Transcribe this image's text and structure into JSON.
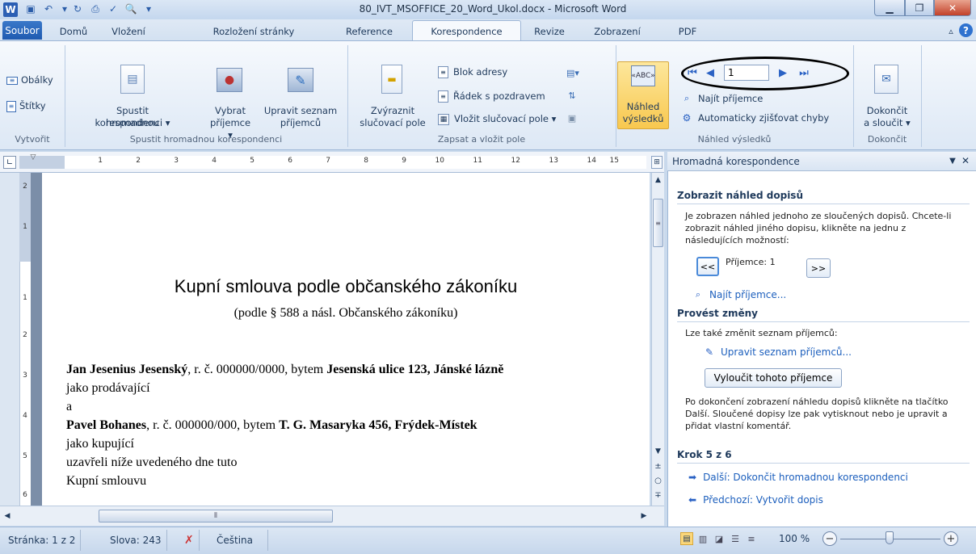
{
  "window": {
    "title": "80_IVT_MSOFFICE_20_Word_Ukol.docx - Microsoft Word"
  },
  "tabs": {
    "file": "Soubor",
    "items": [
      "Domů",
      "Vložení",
      "Rozložení stránky",
      "Reference",
      "Korespondence",
      "Revize",
      "Zobrazení",
      "PDF"
    ]
  },
  "ribbon": {
    "create": {
      "envelopes": "Obálky",
      "labels": "Štítky",
      "group": "Vytvořit"
    },
    "start": {
      "start_line1": "Spustit hromadnou",
      "start_line2": "korespondenci ▾",
      "select_line1": "Vybrat",
      "select_line2": "příjemce ▾",
      "edit_line1": "Upravit seznam",
      "edit_line2": "příjemců",
      "group": "Spustit hromadnou korespondenci"
    },
    "write": {
      "highlight_line1": "Zvýraznit",
      "highlight_line2": "slučovací pole",
      "address_block": "Blok adresy",
      "greeting": "Řádek s pozdravem",
      "insert_field": "Vložit slučovací pole ▾",
      "group": "Zapsat a vložit pole"
    },
    "preview": {
      "preview_line1": "Náhled",
      "preview_line2": "výsledků",
      "record": "1",
      "find": "Najít příjemce",
      "auto_check": "Automaticky zjišťovat chyby",
      "group": "Náhled výsledků"
    },
    "finish": {
      "finish_line1": "Dokončit",
      "finish_line2": "a sloučit ▾",
      "group": "Dokončit"
    }
  },
  "ruler": {
    "marks": [
      "1",
      "2",
      "3",
      "4",
      "5",
      "6",
      "7",
      "8",
      "9",
      "10",
      "11",
      "12",
      "13",
      "14",
      "15"
    ],
    "left_marks": [
      "2",
      "1",
      "1",
      "2",
      "3",
      "4",
      "5",
      "6"
    ]
  },
  "document": {
    "title": "Kupní smlouva podle občanského zákoníku",
    "subtitle": "(podle § 588 a násl. Občanského zákoníku)",
    "seller_name": "Jan Jesenius Jesenský",
    "seller_mid": ", r. č. 000000/0000, bytem ",
    "seller_addr": "Jesenská ulice 123, Jánské lázně",
    "seller_role": "jako prodávající",
    "and": "a",
    "buyer_name": "Pavel Bohanes",
    "buyer_mid": ", r. č. 000000/000, bytem ",
    "buyer_addr": "T. G. Masaryka 456, Frýdek-Místek",
    "buyer_role": "jako kupující",
    "line_concluded": "uzavřeli níže uvedeného dne tuto",
    "line_contract": "Kupní smlouvu"
  },
  "pane": {
    "title": "Hromadná korespondence",
    "preview_heading": "Zobrazit náhled dopisů",
    "preview_text": "Je zobrazen náhled jednoho ze sloučených dopisů. Chcete-li zobrazit náhled jiného dopisu, klikněte na jednu z následujících možností:",
    "prev_btn": "<<",
    "recipient_label": "Příjemce: 1",
    "next_btn": ">>",
    "find_link": "Najít příjemce...",
    "changes_heading": "Provést změny",
    "changes_text": "Lze také změnit seznam příjemců:",
    "edit_link": "Upravit seznam příjemců...",
    "exclude_btn": "Vyloučit tohoto příjemce",
    "finish_text": "Po dokončení zobrazení náhledu dopisů klikněte na tlačítko Další. Sloučené dopisy lze pak vytisknout nebo je upravit a přidat vlastní komentář.",
    "step": "Krok 5 z 6",
    "next_link": "Další: Dokončit hromadnou korespondenci",
    "prev_link": "Předchozí: Vytvořit dopis"
  },
  "status": {
    "page": "Stránka: 1 z 2",
    "words": "Slova: 243",
    "language": "Čeština",
    "zoom": "100 %"
  },
  "colors": {
    "accent": "#1f5ab0",
    "link": "#1c5fbd",
    "annotation": "#000000"
  }
}
